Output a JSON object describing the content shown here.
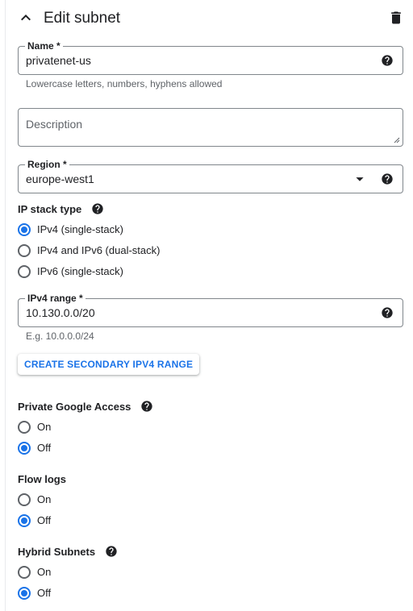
{
  "header": {
    "title": "Edit subnet"
  },
  "name": {
    "label": "Name *",
    "value": "privatenet-us",
    "hint": "Lowercase letters, numbers, hyphens allowed"
  },
  "description": {
    "placeholder": "Description"
  },
  "region": {
    "label": "Region *",
    "value": "europe-west1"
  },
  "ip_stack": {
    "heading": "IP stack type",
    "options": [
      {
        "label": "IPv4 (single-stack)",
        "checked": true
      },
      {
        "label": "IPv4 and IPv6 (dual-stack)",
        "checked": false
      },
      {
        "label": "IPv6 (single-stack)",
        "checked": false
      }
    ]
  },
  "ipv4_range": {
    "label": "IPv4 range *",
    "value": "10.130.0.0/20",
    "hint": "E.g. 10.0.0.0/24"
  },
  "secondary_range_button": {
    "label": "CREATE SECONDARY IPV4 RANGE"
  },
  "private_google_access": {
    "heading": "Private Google Access",
    "options": [
      {
        "label": "On",
        "checked": false
      },
      {
        "label": "Off",
        "checked": true
      }
    ]
  },
  "flow_logs": {
    "heading": "Flow logs",
    "options": [
      {
        "label": "On",
        "checked": false
      },
      {
        "label": "Off",
        "checked": true
      }
    ]
  },
  "hybrid_subnets": {
    "heading": "Hybrid Subnets",
    "options": [
      {
        "label": "On",
        "checked": false
      },
      {
        "label": "Off",
        "checked": true
      }
    ]
  },
  "colors": {
    "accent": "#1a73e8",
    "text": "#202124",
    "secondary_text": "#5f6368",
    "border": "#80868b"
  }
}
